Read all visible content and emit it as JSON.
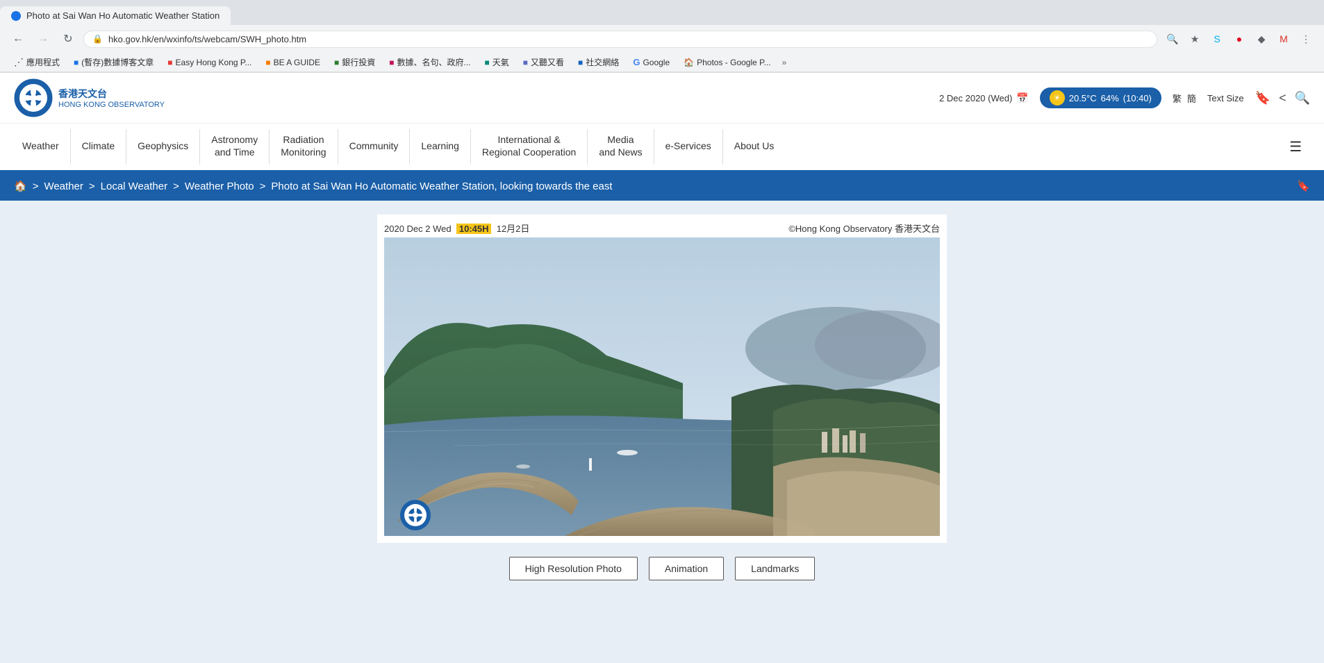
{
  "browser": {
    "url": "hko.gov.hk/en/wxinfo/ts/webcam/SWH_photo.htm",
    "tab_title": "Photo at Sai Wan Ho Automatic Weather Station",
    "back_disabled": false,
    "forward_disabled": true
  },
  "bookmarks": [
    {
      "label": "應用程式",
      "icon": "grid"
    },
    {
      "label": "(暫存)數據博客文章",
      "icon": "bookmark"
    },
    {
      "label": "Easy Hong Kong P...",
      "icon": "bookmark"
    },
    {
      "label": "BE A GUIDE",
      "icon": "bookmark"
    },
    {
      "label": "銀行投資",
      "icon": "bookmark"
    },
    {
      "label": "數據、名句、政府...",
      "icon": "bookmark"
    },
    {
      "label": "天氣",
      "icon": "bookmark"
    },
    {
      "label": "又聽又看",
      "icon": "bookmark"
    },
    {
      "label": "社交網絡",
      "icon": "bookmark"
    },
    {
      "label": "Google",
      "icon": "bookmark"
    },
    {
      "label": "Photos - Google P...",
      "icon": "bookmark"
    }
  ],
  "header": {
    "logo_zh": "香港天文台",
    "logo_en": "HONG KONG OBSERVATORY",
    "date": "2 Dec 2020 (Wed)",
    "temperature": "20.5°C",
    "humidity": "64%",
    "time": "(10:40)",
    "lang_trad": "繁",
    "lang_simp": "簡",
    "text_size": "Text Size"
  },
  "nav": {
    "items": [
      {
        "label": "Weather",
        "id": "weather"
      },
      {
        "label": "Climate",
        "id": "climate"
      },
      {
        "label": "Geophysics",
        "id": "geophysics"
      },
      {
        "label": "Astronomy\nand Time",
        "id": "astronomy"
      },
      {
        "label": "Radiation\nMonitoring",
        "id": "radiation"
      },
      {
        "label": "Community",
        "id": "community"
      },
      {
        "label": "Learning",
        "id": "learning"
      },
      {
        "label": "International &\nRegional Cooperation",
        "id": "international"
      },
      {
        "label": "Media\nand News",
        "id": "media"
      },
      {
        "label": "e-Services",
        "id": "eservices"
      },
      {
        "label": "About Us",
        "id": "about"
      }
    ]
  },
  "breadcrumb": {
    "home": "🏠",
    "items": [
      {
        "label": "Weather",
        "href": "#"
      },
      {
        "label": "Local Weather",
        "href": "#"
      },
      {
        "label": "Weather Photo",
        "href": "#"
      },
      {
        "label": "Photo at Sai Wan Ho Automatic Weather Station, looking towards the east",
        "href": "#"
      }
    ]
  },
  "webcam": {
    "date_label": "2020 Dec 2 Wed",
    "time_highlight": "10:45H",
    "date_zh": "12月2日",
    "copyright": "©Hong Kong Observatory 香港天文台"
  },
  "buttons": [
    {
      "label": "High Resolution Photo",
      "id": "high-res"
    },
    {
      "label": "Animation",
      "id": "animation"
    },
    {
      "label": "Landmarks",
      "id": "landmarks"
    }
  ]
}
